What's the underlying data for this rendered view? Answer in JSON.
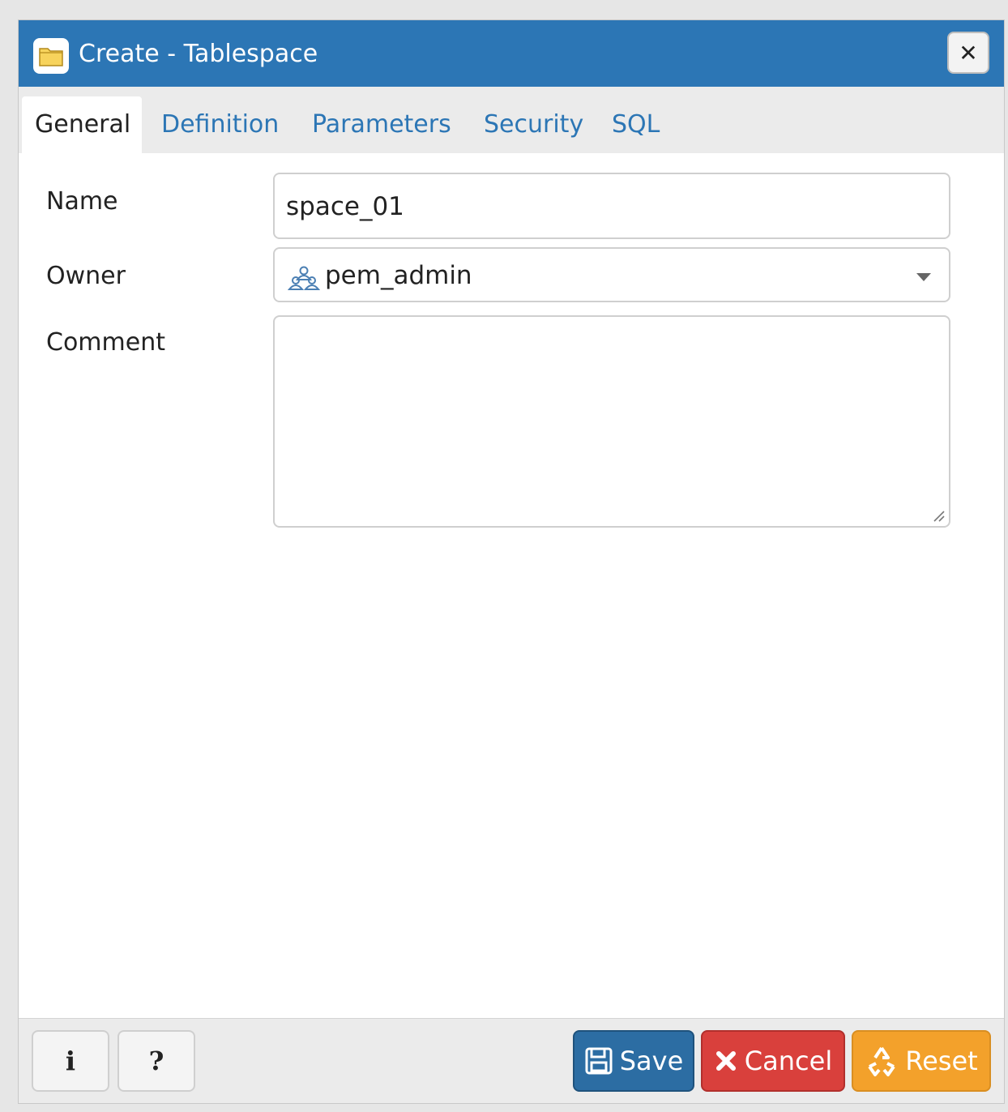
{
  "window": {
    "title": "Create - Tablespace",
    "close_icon": "close-icon",
    "title_icon": "folder-icon"
  },
  "tabs": [
    {
      "label": "General",
      "active": true
    },
    {
      "label": "Definition",
      "active": false
    },
    {
      "label": "Parameters",
      "active": false
    },
    {
      "label": "Security",
      "active": false
    },
    {
      "label": "SQL",
      "active": false
    }
  ],
  "form": {
    "name": {
      "label": "Name",
      "value": "space_01"
    },
    "owner": {
      "label": "Owner",
      "value": "pem_admin",
      "icon": "group-role-icon"
    },
    "comment": {
      "label": "Comment",
      "value": ""
    }
  },
  "footer": {
    "info_label": "i",
    "help_label": "?",
    "save_label": "Save",
    "cancel_label": "Cancel",
    "reset_label": "Reset"
  },
  "colors": {
    "titlebar": "#2c76b5",
    "save": "#2c6da3",
    "cancel": "#d9403c",
    "reset": "#f3a12b"
  }
}
